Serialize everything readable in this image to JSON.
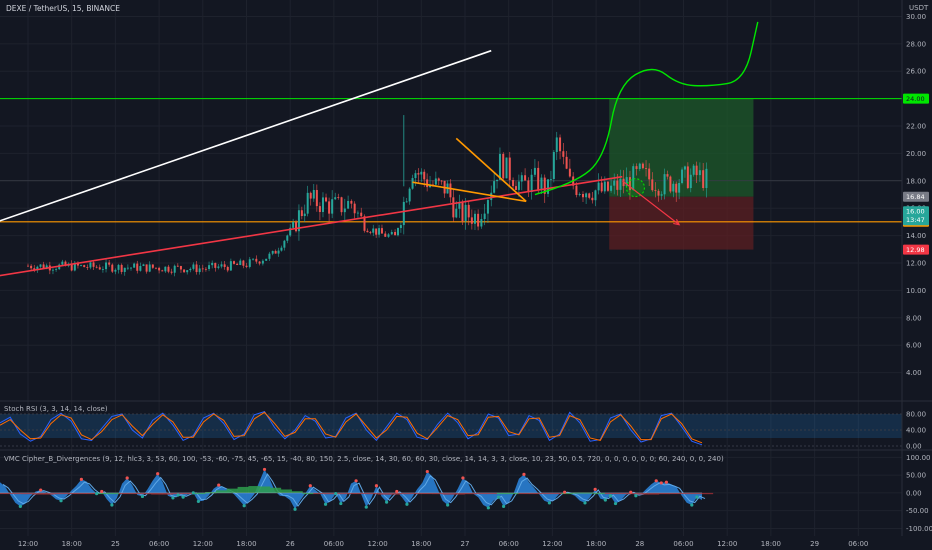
{
  "chart_data": [
    {
      "type": "line",
      "title": "DEXE / TetherUS, 15, BINANCE",
      "y_axis_label": "USDT",
      "yticks": [
        "4.00",
        "6.00",
        "8.00",
        "10.00",
        "12.00",
        "14.00",
        "16.00",
        "18.00",
        "20.00",
        "22.00",
        "26.00",
        "28.00",
        "30.00"
      ],
      "xticks": [
        "12:00",
        "18:00",
        "25",
        "06:00",
        "12:00",
        "18:00",
        "26",
        "06:00",
        "12:00",
        "18:00",
        "27",
        "06:00",
        "12:00",
        "18:00",
        "28",
        "06:00",
        "12:00",
        "18:00",
        "29",
        "06:00"
      ],
      "ylim": [
        2.0,
        31.2
      ],
      "price_path_x_index": [
        0,
        2,
        4,
        5,
        5.6,
        6,
        6.4,
        7.1,
        7.4,
        7.7,
        8.1,
        8.4,
        8.8,
        9.2,
        9.6,
        9.8,
        10.3,
        10.6,
        10.8,
        11.1,
        11.3,
        11.6,
        11.9,
        12.1,
        12.4,
        12.7,
        13.2,
        13.7,
        14.0,
        14.5,
        14.9,
        15.3,
        15.6
      ],
      "price_path_y": [
        11.8,
        11.7,
        11.6,
        11.9,
        12.6,
        14.3,
        16.6,
        16.1,
        16.4,
        14.7,
        14.1,
        13.9,
        18.9,
        17.8,
        17.4,
        15.6,
        15.4,
        17.6,
        19.3,
        18.3,
        17.6,
        18.1,
        17.3,
        20.8,
        17.8,
        17.4,
        17.2,
        17.9,
        18.5,
        17.7,
        18.1,
        18.4,
        18.0
      ],
      "current_price": "16.00",
      "countdown": "13:47",
      "price_levels": [
        {
          "name": "green-resistance",
          "value": 24.0,
          "label": "24.00",
          "color": "#00e600"
        },
        {
          "name": "gray-level",
          "value": 16.84,
          "label": "16.84",
          "color": "#787b86"
        },
        {
          "name": "orange-support",
          "value": 15.01,
          "label": "15.01",
          "color": "#ff9800"
        },
        {
          "name": "stop-loss",
          "value": 12.98,
          "label": "12.98",
          "color": "#f23645"
        }
      ],
      "position": {
        "entry": 16.84,
        "target": 24.0,
        "stop": 12.98,
        "target_color": "#1e5a2a",
        "stop_color": "#5c1f22"
      },
      "trendlines": [
        {
          "name": "white-upper-trend",
          "color": "#ffffff",
          "points": [
            [
              -1.8,
              13.8
            ],
            [
              10.6,
              27.5
            ]
          ]
        },
        {
          "name": "red-lower-trend",
          "color": "#f23645",
          "points": [
            [
              -1.8,
              10.5
            ],
            [
              13.6,
              18.3
            ]
          ]
        },
        {
          "name": "orange-wedge-top",
          "color": "#ff9800",
          "points": [
            [
              9.8,
              21.1
            ],
            [
              11.4,
              16.5
            ]
          ]
        },
        {
          "name": "orange-wedge-bottom",
          "color": "#ff9800",
          "points": [
            [
              8.8,
              17.9
            ],
            [
              11.4,
              16.5
            ]
          ]
        }
      ],
      "forecast_path_x": [
        11.6,
        12.5,
        13.2,
        13.5,
        14.3,
        14.9,
        15.6,
        16.4,
        16.7
      ],
      "forecast_path_y": [
        17.0,
        17.8,
        19.7,
        25.0,
        26.5,
        25.0,
        24.9,
        25.3,
        29.6
      ],
      "forecast_color": "#00e600",
      "bearish_arrow": {
        "from": [
          13.6,
          18.0
        ],
        "to": [
          14.9,
          14.8
        ],
        "color": "#f23645"
      }
    },
    {
      "type": "line",
      "title": "Stoch RSI (3, 3, 14, 14, close)",
      "yticks": [
        "80.00",
        "40.00",
        "0.00"
      ],
      "ylim": [
        -5,
        110
      ],
      "band": [
        20,
        80
      ],
      "series": [
        {
          "color": "#2962ff",
          "values": [
            58,
            72,
            30,
            12,
            24,
            66,
            82,
            62,
            18,
            14,
            44,
            74,
            80,
            40,
            20,
            64,
            82,
            52,
            14,
            26,
            70,
            82,
            56,
            16,
            30,
            78,
            86,
            46,
            18,
            40,
            76,
            62,
            20,
            24,
            70,
            82,
            40,
            14,
            48,
            82,
            66,
            22,
            16,
            54,
            82,
            58,
            18,
            34,
            80,
            70,
            26,
            30,
            76,
            64,
            14,
            30,
            84,
            58,
            12,
            16,
            70,
            80,
            40,
            10,
            18,
            76,
            82,
            48,
            12,
            3
          ]
        },
        {
          "color": "#ff6d00",
          "values": [
            52,
            66,
            40,
            18,
            20,
            56,
            78,
            70,
            28,
            16,
            36,
            66,
            78,
            50,
            26,
            54,
            78,
            60,
            22,
            22,
            60,
            80,
            64,
            24,
            26,
            68,
            84,
            56,
            24,
            34,
            68,
            68,
            30,
            22,
            60,
            80,
            50,
            20,
            40,
            74,
            72,
            32,
            18,
            46,
            76,
            66,
            26,
            28,
            72,
            74,
            36,
            28,
            68,
            70,
            22,
            26,
            76,
            66,
            20,
            14,
            60,
            78,
            50,
            16,
            16,
            68,
            80,
            56,
            18,
            8
          ]
        }
      ]
    },
    {
      "type": "area",
      "title": "VMC Cipher_B_Divergences (9, 12, hlc3, 3, 53, 60, 100, -53, -60, -75, 45, -65, 15, -40, 80, 150, 2.5, close, 14, 30, 60, 60, 30, close, 14, 14, 3, 3, close, 10, 23, 50, 0.5, 720, 0, 0, 0, 0, 0, 0; 60, 240, 0, 0, 240)",
      "yticks": [
        "100.00",
        "50.00",
        "0.00",
        "-50.00",
        "-100.00"
      ],
      "ylim": [
        -110,
        115
      ],
      "wave": [
        30,
        18,
        -5,
        -28,
        -38,
        -30,
        -10,
        4,
        8,
        2,
        -6,
        -18,
        -22,
        -10,
        6,
        20,
        38,
        32,
        12,
        -2,
        4,
        -18,
        -34,
        -14,
        26,
        42,
        22,
        -6,
        -10,
        10,
        34,
        54,
        30,
        -8,
        -14,
        -6,
        -12,
        -4,
        0,
        -24,
        -22,
        -8,
        12,
        22,
        14,
        6,
        -4,
        -20,
        -36,
        -22,
        -4,
        32,
        66,
        40,
        6,
        -8,
        -10,
        -20,
        -46,
        -22,
        -2,
        20,
        8,
        -4,
        -32,
        -22,
        -2,
        -30,
        -14,
        26,
        34,
        -4,
        -40,
        -16,
        20,
        -10,
        -26,
        -6,
        4,
        -12,
        -32,
        -14,
        10,
        28,
        60,
        46,
        12,
        -22,
        -34,
        -14,
        12,
        42,
        28,
        -2,
        -12,
        -34,
        -42,
        -22,
        -12,
        -38,
        -28,
        0,
        40,
        52,
        30,
        14,
        -4,
        -22,
        -28,
        -18,
        -2,
        2,
        -2,
        -8,
        -22,
        -28,
        -12,
        10,
        -16,
        -20,
        -8,
        -30,
        -22,
        -6,
        2,
        -8,
        -4,
        10,
        24,
        34,
        28,
        30,
        24,
        16,
        -8,
        -28,
        -34,
        -12,
        -20
      ],
      "mfi": [
        -2,
        -2,
        -3,
        -4,
        -4,
        -3,
        -2,
        -2,
        -1,
        0,
        0,
        -1,
        -2,
        -3,
        -4,
        -4,
        -3,
        -2,
        0,
        2,
        6,
        10,
        14,
        16,
        15,
        12,
        8,
        4,
        0,
        -2,
        -3,
        -3,
        -2,
        -2,
        -3,
        -4,
        -4,
        -3,
        -2,
        -2,
        -3,
        -4,
        -4,
        -3,
        -2,
        -1,
        0,
        0,
        -1,
        -2,
        -2,
        -1,
        0,
        1,
        1,
        0,
        -1,
        -2,
        -3,
        -4,
        -4,
        -3,
        -2,
        -2,
        -2,
        -3
      ],
      "wave_color": "#2a7fd4",
      "light_wave_color": "#5fa8e6",
      "mfi_pos_color": "#2e9e4c",
      "mfi_neg_color": "#9b2d34"
    }
  ]
}
